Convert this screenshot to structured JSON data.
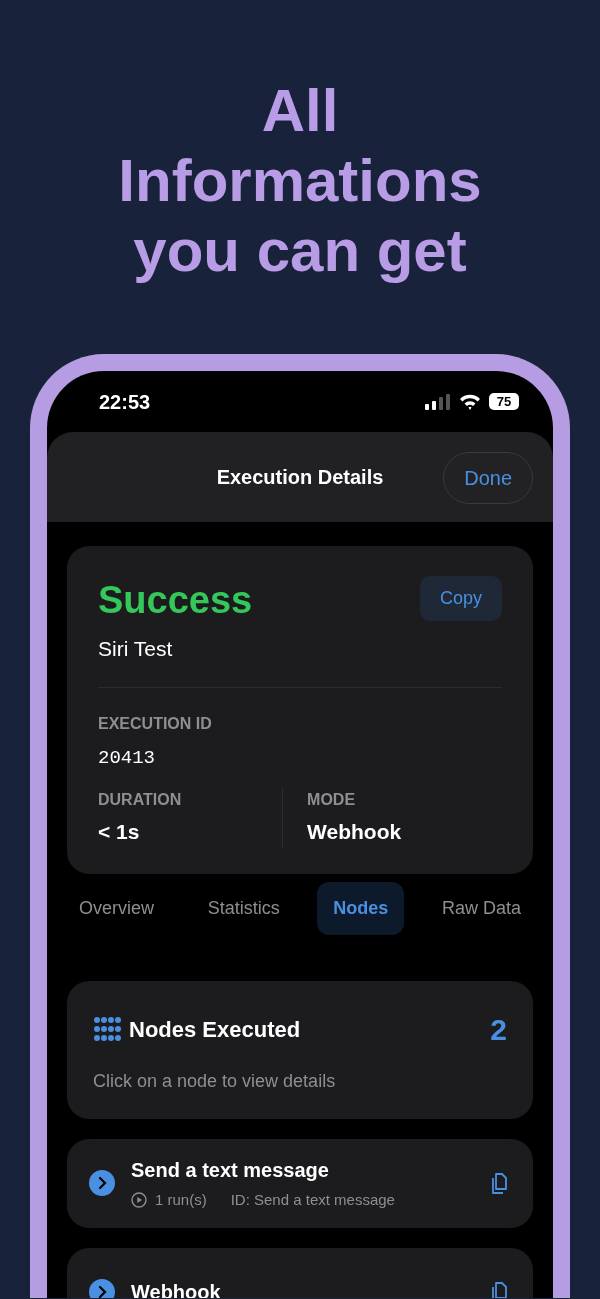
{
  "headline": {
    "lines": [
      "All",
      "Informations",
      "you can get"
    ]
  },
  "status_bar": {
    "time": "22:53",
    "battery": "75"
  },
  "sheet": {
    "title": "Execution Details",
    "done_button": "Done"
  },
  "summary": {
    "status": "Success",
    "copy_button": "Copy",
    "workflow": "Siri Test",
    "fields": [
      {
        "label": "EXECUTION ID",
        "value": "20413",
        "kind": "mono"
      }
    ],
    "stats": [
      {
        "label": "DURATION",
        "value": "< 1s"
      },
      {
        "label": "MODE",
        "value": "Webhook"
      }
    ]
  },
  "tabs": [
    {
      "label": "Overview",
      "selected": false
    },
    {
      "label": "Statistics",
      "selected": false
    },
    {
      "label": "Nodes",
      "selected": true
    },
    {
      "label": "Raw Data",
      "selected": false
    }
  ],
  "nodes_header": {
    "title": "Nodes Executed",
    "count": "2",
    "hint": "Click on a node to view details"
  },
  "nodes": [
    {
      "name": "Send a text message",
      "runs": "1 run(s)",
      "id": "ID: Send a text message"
    },
    {
      "name": "Webhook"
    }
  ]
}
